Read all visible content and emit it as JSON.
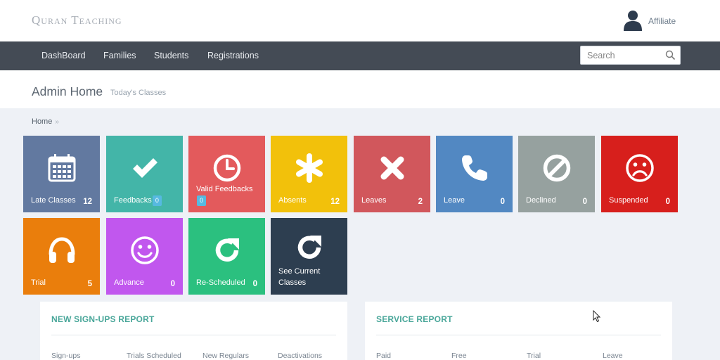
{
  "header": {
    "brand": "Quran Teaching",
    "user_label": "Affiliate",
    "user_icon": "user-icon"
  },
  "nav": {
    "items": [
      {
        "label": "DashBoard"
      },
      {
        "label": "Families"
      },
      {
        "label": "Students"
      },
      {
        "label": "Registrations"
      }
    ],
    "search_placeholder": "Search"
  },
  "page": {
    "title": "Admin Home",
    "subtitle": "Today's Classes",
    "breadcrumb": "Home",
    "breadcrumb_sep": "»"
  },
  "tiles": [
    {
      "label": "Late Classes",
      "count": "12",
      "color": "#6279a0",
      "icon": "calendar-icon"
    },
    {
      "label": "Feedbacks",
      "badge": "0",
      "color": "#43b5a8",
      "icon": "check-icon"
    },
    {
      "label": "Valid Feedbacks",
      "badge": "0",
      "color": "#e35a5c",
      "icon": "clock-icon"
    },
    {
      "label": "Absents",
      "count": "12",
      "color": "#f2c10b",
      "icon": "asterisk-icon"
    },
    {
      "label": "Leaves",
      "count": "2",
      "color": "#d1575c",
      "icon": "x-icon"
    },
    {
      "label": "Leave",
      "count": "0",
      "color": "#5288c2",
      "icon": "phone-icon"
    },
    {
      "label": "Declined",
      "count": "0",
      "color": "#96a19f",
      "icon": "ban-icon"
    },
    {
      "label": "Suspended",
      "count": "0",
      "color": "#d71f1c",
      "icon": "frown-icon"
    },
    {
      "label": "Trial",
      "count": "5",
      "color": "#ea7e0c",
      "icon": "headphones-icon"
    },
    {
      "label": "Advance",
      "count": "0",
      "color": "#c157ee",
      "icon": "smile-icon"
    },
    {
      "label": "Re-Scheduled",
      "count": "0",
      "color": "#2bc07f",
      "icon": "refresh-icon"
    },
    {
      "label": "See Current Classes",
      "color": "#2d3e50",
      "icon": "refresh-icon"
    }
  ],
  "panels": {
    "signups": {
      "title": "NEW SIGN-UPS REPORT",
      "columns": [
        "Sign-ups",
        "Trials Scheduled",
        "New Regulars",
        "Deactivations"
      ]
    },
    "service": {
      "title": "SERVICE REPORT",
      "columns": [
        "Paid",
        "Free",
        "Trial",
        "Leave"
      ]
    }
  }
}
